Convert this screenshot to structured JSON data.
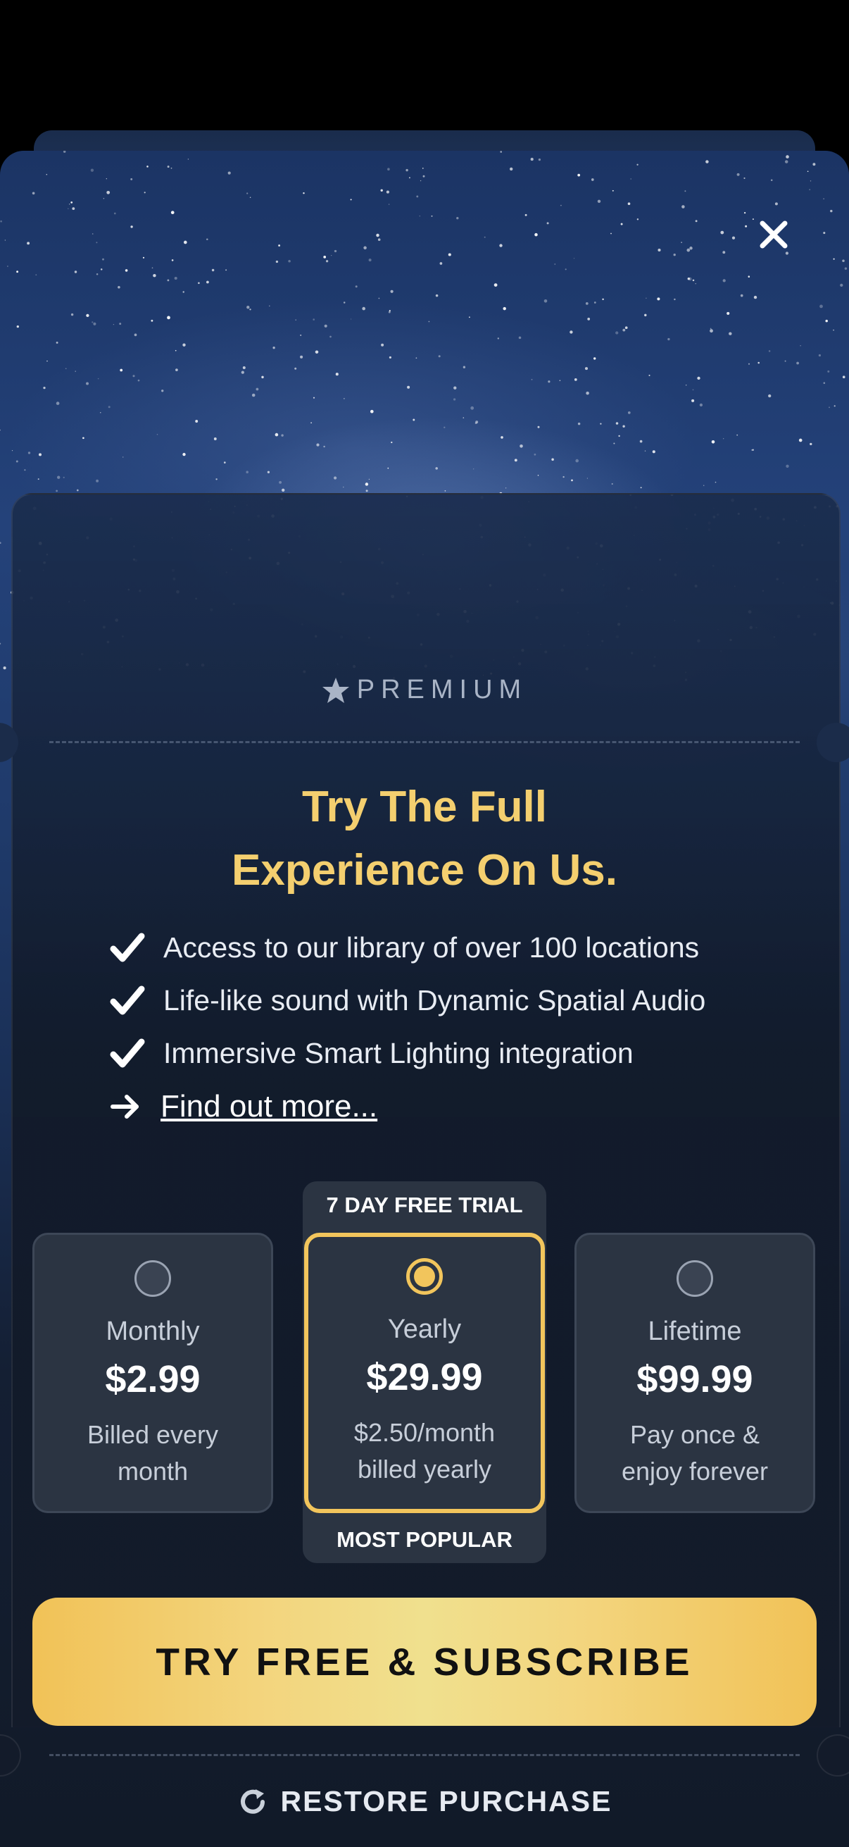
{
  "header": {
    "close_icon": "close-icon"
  },
  "premium": {
    "label": "PREMIUM",
    "icon": "star-icon"
  },
  "headline": {
    "line1": "Try The Full",
    "line2": "Experience On Us."
  },
  "features": [
    {
      "text": "Access to our library of over 100 locations",
      "icon": "check-icon"
    },
    {
      "text": "Life-like sound with Dynamic Spatial Audio",
      "icon": "check-icon"
    },
    {
      "text": "Immersive Smart Lighting integration",
      "icon": "check-icon"
    }
  ],
  "find_more": {
    "label": "Find out more...",
    "icon": "arrow-right-icon"
  },
  "plans": [
    {
      "name": "Monthly",
      "price": "$2.99",
      "desc_line1": "Billed every",
      "desc_line2": "month",
      "selected": false
    },
    {
      "name": "Yearly",
      "price": "$29.99",
      "desc_line1": "$2.50/month",
      "desc_line2": "billed yearly",
      "selected": true,
      "top_badge": "7 DAY FREE TRIAL",
      "bottom_badge": "MOST POPULAR"
    },
    {
      "name": "Lifetime",
      "price": "$99.99",
      "desc_line1": "Pay once &",
      "desc_line2": "enjoy forever",
      "selected": false
    }
  ],
  "cta": {
    "label": "TRY FREE & SUBSCRIBE"
  },
  "restore": {
    "label": "RESTORE PURCHASE",
    "icon": "refresh-icon"
  },
  "colors": {
    "accent": "#f2c55c",
    "headline": "#f4cf6f",
    "card_bg": "#2b3442",
    "page_bg": "#131b2a"
  }
}
